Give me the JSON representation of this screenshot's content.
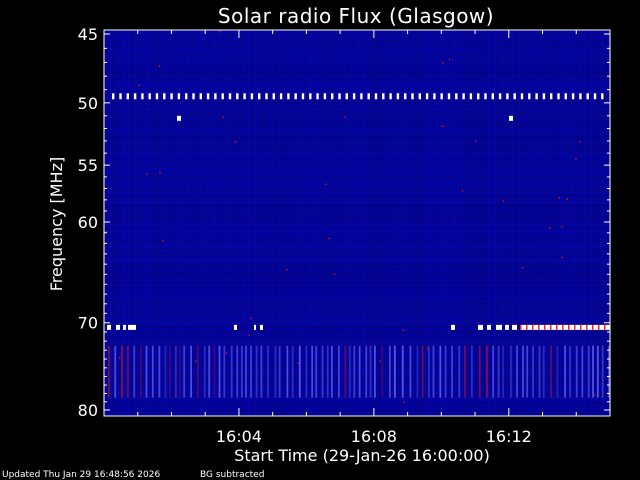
{
  "chart_data": {
    "type": "heatmap",
    "title": "Solar radio Flux (Glasgow)",
    "xlabel": "Start Time (29-Jan-26 16:00:00)",
    "ylabel": "Frequency [MHz]",
    "x_ticks": [
      "16:04",
      "16:08",
      "16:12"
    ],
    "y_ticks": [
      "45",
      "50",
      "55",
      "60",
      "70",
      "80"
    ],
    "x_range_minutes": [
      0,
      15
    ],
    "y_range_mhz": [
      45,
      80
    ],
    "y_scale": "log",
    "grid": false,
    "colormap": [
      "#000040",
      "#0a0ad2",
      "#ff0000",
      "#ffffff"
    ],
    "features": [
      {
        "kind": "interference_band",
        "frequency_mhz": 49.5,
        "pattern": "dashed",
        "color": "#ffffff"
      },
      {
        "kind": "interference_band",
        "frequency_mhz": 70.5,
        "pattern": "intermittent",
        "color": "#ffffff"
      },
      {
        "kind": "striped_region",
        "frequency_range_mhz": [
          72.5,
          78.5
        ],
        "pattern": "vertical stripes"
      }
    ]
  },
  "footer": {
    "updated": "Updated Thu Jan 29 16:48:56 2026",
    "note": "BG subtracted"
  }
}
